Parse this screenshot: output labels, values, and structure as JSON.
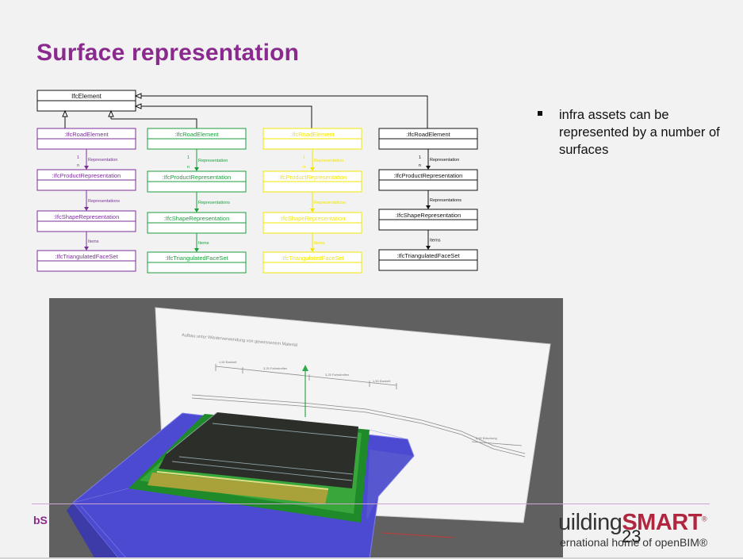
{
  "slide": {
    "title": "Surface representation",
    "bullet": "infra assets can be represented by a number of surfaces",
    "footer_left": "bS",
    "brand_prefix": "uilding",
    "brand_smart": "SMART",
    "brand_reg": "®",
    "tagline": "ernational home of openBIM®",
    "page_number": "23"
  },
  "diagram": {
    "root_label": "IfcElement",
    "columns": [
      {
        "color": "#7b2f9a",
        "labels": [
          ":IfcRoadElement",
          ":IfcProductRepresentation",
          ":IfcShapeRepresentation",
          ":IfcTriangulatedFaceSet"
        ],
        "rel1": "Representation",
        "rel2": "Representations",
        "rel3": "Items",
        "mult_one": "1",
        "mult_n": "n"
      },
      {
        "color": "#1b9e3e",
        "labels": [
          ":IfcRoadElement",
          ":IfcProductRepresentation",
          ":IfcShapeRepresentation",
          ":IfcTriangulatedFaceSet"
        ],
        "rel1": "Representation",
        "rel2": "Representations",
        "rel3": "Items",
        "mult_one": "1",
        "mult_n": "n"
      },
      {
        "color": "#f2e600",
        "labels": [
          ":IfcRoadElement",
          ":IfcProductRepresentation",
          ":IfcShapeRepresentation",
          ":IfcTriangulatedFaceSet"
        ],
        "rel1": "Representation",
        "rel2": "Representations",
        "rel3": "Items",
        "mult_one": "1",
        "mult_n": "n"
      },
      {
        "color": "#111111",
        "labels": [
          ":IfcRoadElement",
          ":IfcProductRepresentation",
          ":IfcShapeRepresentation",
          ":IfcTriangulatedFaceSet"
        ],
        "rel1": "Representation",
        "rel2": "Representations",
        "rel3": "Items",
        "mult_one": "1",
        "mult_n": "n"
      }
    ]
  },
  "render": {
    "sheet_title": "Aufbau unter Wiederverwendung von gewonnenem Material",
    "dim_labels": [
      "1,50 Bankett",
      "3,25 Fahrstreifen",
      "3,25 Fahrstreifen",
      "1,50 Bankett"
    ],
    "side_label": "2,50 Böschung"
  },
  "colors": {
    "accent": "#8b2a8e",
    "brand_red": "#b0263f",
    "embankment": "#4b4ad0",
    "asphalt": "#2c2e2a",
    "green": "#2e9a2e",
    "gravel": "#a9a23a"
  }
}
